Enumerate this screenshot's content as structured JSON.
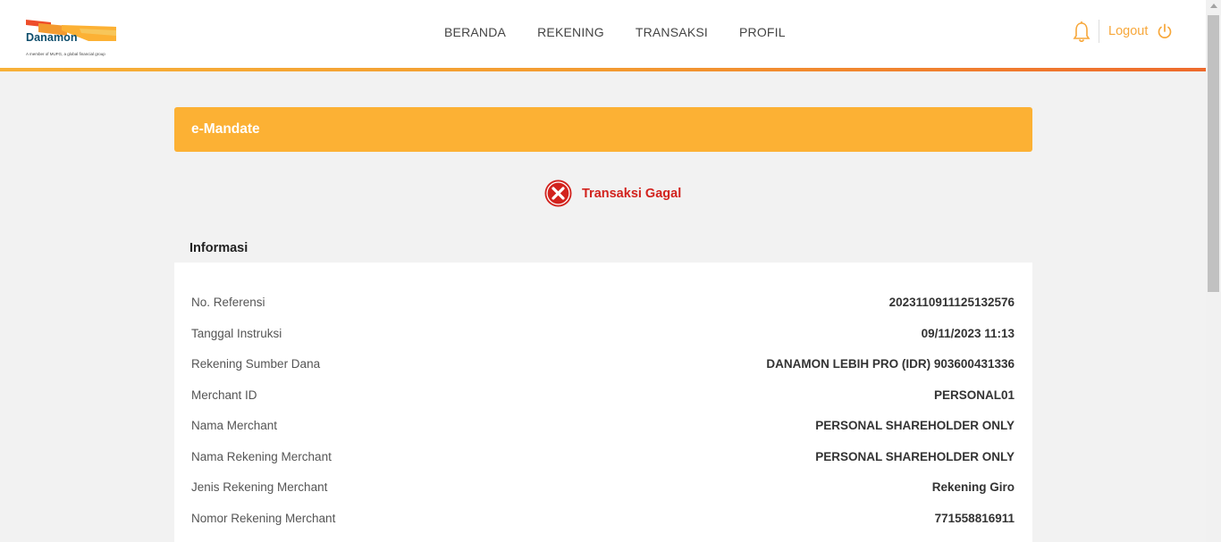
{
  "brand": {
    "name": "Danamon",
    "tagline": "A member of MUFG, a global financial group",
    "colors": {
      "orange": "#fcb134",
      "dark_orange": "#ee6a2c",
      "navy": "#0d4d6b",
      "red": "#d2231e"
    }
  },
  "nav": {
    "items": [
      {
        "label": "BERANDA"
      },
      {
        "label": "REKENING"
      },
      {
        "label": "TRANSAKSI"
      },
      {
        "label": "PROFIL"
      }
    ]
  },
  "header": {
    "bell_icon": "bell-icon",
    "logout_label": "Logout",
    "logout_icon": "power-icon"
  },
  "page": {
    "title": "e-Mandate",
    "status_text": "Transaksi Gagal",
    "status_icon": "error-x-icon",
    "section_title": "Informasi"
  },
  "info": {
    "rows": [
      {
        "label": "No. Referensi",
        "value": "2023110911125132576"
      },
      {
        "label": "Tanggal Instruksi",
        "value": "09/11/2023 11:13"
      },
      {
        "label": "Rekening Sumber Dana",
        "value": "DANAMON LEBIH PRO (IDR) 903600431336"
      },
      {
        "label": "Merchant ID",
        "value": "PERSONAL01"
      },
      {
        "label": "Nama Merchant",
        "value": "PERSONAL SHAREHOLDER ONLY"
      },
      {
        "label": "Nama Rekening Merchant",
        "value": "PERSONAL SHAREHOLDER ONLY"
      },
      {
        "label": "Jenis Rekening Merchant",
        "value": "Rekening Giro"
      },
      {
        "label": "Nomor Rekening Merchant",
        "value": "771558816911"
      }
    ]
  }
}
